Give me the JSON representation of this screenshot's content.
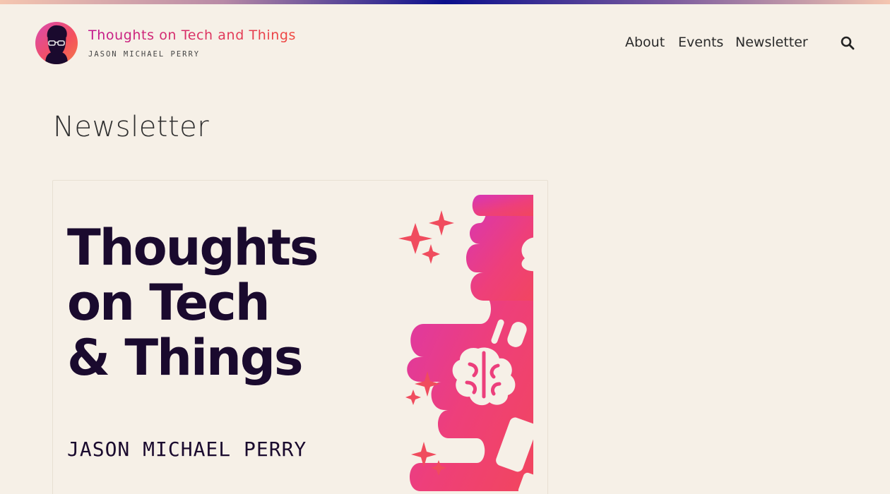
{
  "site": {
    "title": "Thoughts on Tech and Things",
    "subtitle": "JASON MICHAEL PERRY"
  },
  "nav": {
    "items": [
      {
        "label": "About"
      },
      {
        "label": "Events"
      },
      {
        "label": "Newsletter"
      }
    ],
    "search_icon": "search-icon"
  },
  "page": {
    "title": "Newsletter"
  },
  "cover": {
    "title": "Thoughts\non Tech\n& Things",
    "author": "JASON MICHAEL PERRY"
  },
  "colors": {
    "background": "#f6f0e7",
    "accent_pink": "#d94ab0",
    "accent_coral": "#f4505e",
    "text_dark": "#1a0a2e"
  }
}
